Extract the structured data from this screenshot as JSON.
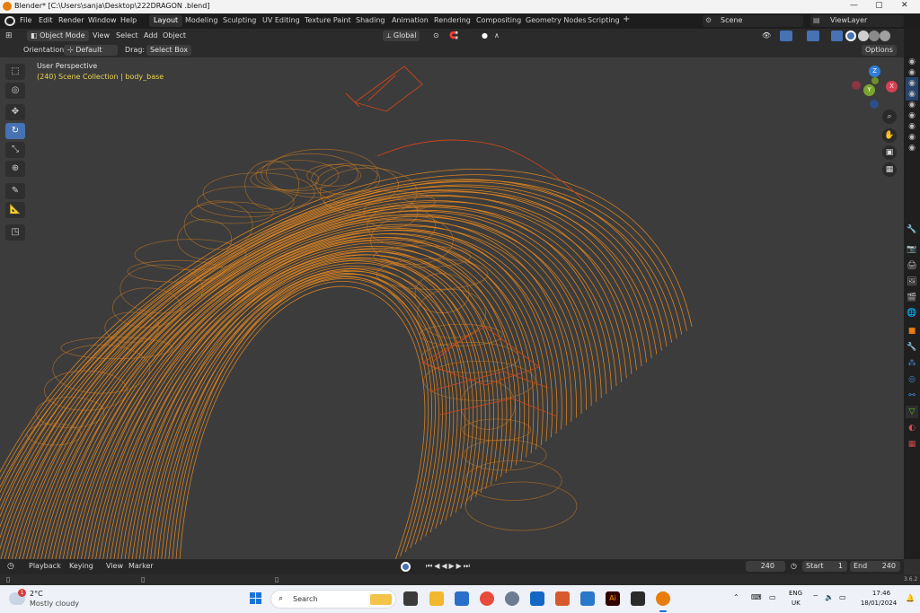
{
  "window": {
    "title": "Blender* [C:\\Users\\sanja\\Desktop\\222DRAGON .blend]",
    "minimize": "—",
    "maximize": "▢",
    "close": "✕"
  },
  "menu": {
    "items": [
      "File",
      "Edit",
      "Render",
      "Window",
      "Help"
    ],
    "workspaces": [
      "Layout",
      "Modeling",
      "Sculpting",
      "UV Editing",
      "Texture Paint",
      "Shading",
      "Animation",
      "Rendering",
      "Compositing",
      "Geometry Nodes",
      "Scripting"
    ],
    "add_workspace": "+",
    "scene": "Scene",
    "view_layer": "ViewLayer"
  },
  "header": {
    "mode": "Object Mode",
    "view": "View",
    "select": "Select",
    "add": "Add",
    "object": "Object",
    "transform": "Global",
    "orientation_label": "Orientation:",
    "orientation_value": "Default",
    "drag_label": "Drag:",
    "drag_value": "Select Box",
    "options": "Options"
  },
  "viewport": {
    "perspective": "User Perspective",
    "collection": "(240) Scene Collection | body_base",
    "gizmo": {
      "z": "Z",
      "y": "Y",
      "x": "X"
    }
  },
  "timeline": {
    "playback": "Playback",
    "keying": "Keying",
    "view": "View",
    "marker": "Marker",
    "current_frame": "240",
    "start_label": "Start",
    "start_value": "1",
    "end_label": "End",
    "end_value": "240",
    "version": "3.6.2"
  },
  "taskbar": {
    "temperature": "2°C",
    "weather": "Mostly cloudy",
    "notification_badge": "1",
    "search": "Search",
    "lang": "ENG",
    "region": "UK",
    "time": "17:46",
    "date": "18/01/2024"
  },
  "colors": {
    "wire": "#e8891f",
    "wire_dark": "#c8451a",
    "accent": "#4772b3",
    "blender_orange": "#e87d0d"
  }
}
